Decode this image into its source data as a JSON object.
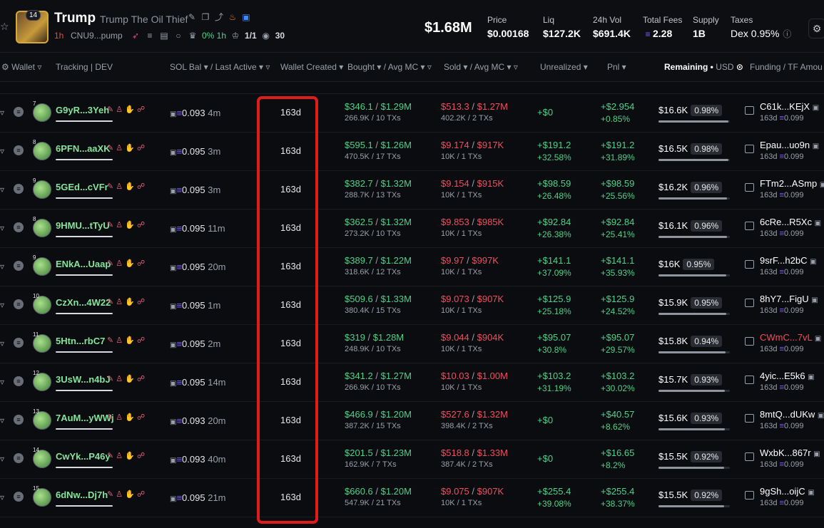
{
  "token": {
    "name": "Trump",
    "subtitle": "Trump The Oil Thief",
    "age": "1h",
    "contract": "CNU9...pump",
    "holders_change": "0% 1h",
    "ratio": "1/1",
    "watchers": "30",
    "logo_badge": "14",
    "market_cap": "$1.68M"
  },
  "stats": [
    {
      "label": "Price",
      "value": "$0.00168"
    },
    {
      "label": "Liq",
      "value": "$127.2K"
    },
    {
      "label": "24h Vol",
      "value": "$691.4K"
    },
    {
      "label": "Total Fees",
      "value": "2.28"
    },
    {
      "label": "Supply",
      "value": "1B"
    },
    {
      "label": "Taxes",
      "value": "Dex 0.95%"
    }
  ],
  "columns": {
    "wallet": "Wallet",
    "tracking": "Tracking",
    "dev": "DEV",
    "sol_bal": "SOL Bal",
    "last_active": "Last Active",
    "wallet_created": "Wallet Created",
    "bought": "Bought",
    "avg_mc": "Avg MC",
    "sold": "Sold",
    "avg_mc2": "Avg MC",
    "unrealized": "Unrealized",
    "pnl": "Pnl",
    "remaining": "Remaining",
    "usd": "USD",
    "funding": "Funding / TF Amou"
  },
  "rows": [
    {
      "rank": "7",
      "wallet": "G9yR...3Yeh",
      "sol": "0.093",
      "ago": "4m",
      "created": "163d",
      "bought": "$346.1",
      "bought_mc": "$1.29M",
      "bought_sub": "266.9K / 10 TXs",
      "sold": "$513.3",
      "sold_mc": "$1.27M",
      "sold_sub": "402.2K / 2 TXs",
      "unreal": "+$0",
      "unreal_pct": "",
      "pnl": "+$2.954",
      "pnl_pct": "+0.85%",
      "remain": "$16.6K",
      "remain_pct": "0.98%",
      "remain_fill": 0.98,
      "fund": "C61k...KEjX",
      "fund_sub": "163d",
      "fund_amt": "0.099",
      "fund_red": false
    },
    {
      "rank": "8",
      "wallet": "6PFN...aaXK",
      "sol": "0.095",
      "ago": "3m",
      "created": "163d",
      "bought": "$595.1",
      "bought_mc": "$1.26M",
      "bought_sub": "470.5K / 17 TXs",
      "sold": "$9.174",
      "sold_mc": "$917K",
      "sold_sub": "10K / 1 TXs",
      "unreal": "+$191.2",
      "unreal_pct": "+32.58%",
      "pnl": "+$191.2",
      "pnl_pct": "+31.89%",
      "remain": "$16.5K",
      "remain_pct": "0.98%",
      "remain_fill": 0.98,
      "fund": "Epau...uo9n",
      "fund_sub": "163d",
      "fund_amt": "0.099",
      "fund_red": false
    },
    {
      "rank": "9",
      "wallet": "5GEd...cVFr",
      "sol": "0.095",
      "ago": "3m",
      "created": "163d",
      "bought": "$382.7",
      "bought_mc": "$1.32M",
      "bought_sub": "288.7K / 13 TXs",
      "sold": "$9.154",
      "sold_mc": "$915K",
      "sold_sub": "10K / 1 TXs",
      "unreal": "+$98.59",
      "unreal_pct": "+26.48%",
      "pnl": "+$98.59",
      "pnl_pct": "+25.56%",
      "remain": "$16.2K",
      "remain_pct": "0.96%",
      "remain_fill": 0.96,
      "fund": "FTm2...ASmp",
      "fund_sub": "163d",
      "fund_amt": "0.099",
      "fund_red": false
    },
    {
      "rank": "8",
      "wallet": "9HMU...tTyU",
      "sol": "0.095",
      "ago": "11m",
      "created": "163d",
      "bought": "$362.5",
      "bought_mc": "$1.32M",
      "bought_sub": "273.2K / 10 TXs",
      "sold": "$9.853",
      "sold_mc": "$985K",
      "sold_sub": "10K / 1 TXs",
      "unreal": "+$92.84",
      "unreal_pct": "+26.38%",
      "pnl": "+$92.84",
      "pnl_pct": "+25.41%",
      "remain": "$16.1K",
      "remain_pct": "0.96%",
      "remain_fill": 0.96,
      "fund": "6cRe...R5Xc",
      "fund_sub": "163d",
      "fund_amt": "0.099",
      "fund_red": false
    },
    {
      "rank": "9",
      "wallet": "ENkA...Uaap",
      "sol": "0.095",
      "ago": "20m",
      "created": "163d",
      "bought": "$389.7",
      "bought_mc": "$1.22M",
      "bought_sub": "318.6K / 12 TXs",
      "sold": "$9.97",
      "sold_mc": "$997K",
      "sold_sub": "10K / 1 TXs",
      "unreal": "+$141.1",
      "unreal_pct": "+37.09%",
      "pnl": "+$141.1",
      "pnl_pct": "+35.93%",
      "remain": "$16K",
      "remain_pct": "0.95%",
      "remain_fill": 0.95,
      "fund": "9srF...h2bC",
      "fund_sub": "163d",
      "fund_amt": "0.099",
      "fund_red": false
    },
    {
      "rank": "10",
      "wallet": "CzXn...4W22",
      "sol": "0.095",
      "ago": "1m",
      "created": "163d",
      "bought": "$509.6",
      "bought_mc": "$1.33M",
      "bought_sub": "380.4K / 15 TXs",
      "sold": "$9.073",
      "sold_mc": "$907K",
      "sold_sub": "10K / 1 TXs",
      "unreal": "+$125.9",
      "unreal_pct": "+25.18%",
      "pnl": "+$125.9",
      "pnl_pct": "+24.52%",
      "remain": "$15.9K",
      "remain_pct": "0.95%",
      "remain_fill": 0.95,
      "fund": "8hY7...FigU",
      "fund_sub": "163d",
      "fund_amt": "0.099",
      "fund_red": false
    },
    {
      "rank": "11",
      "wallet": "5Htn...rbC7",
      "sol": "0.095",
      "ago": "2m",
      "created": "163d",
      "bought": "$319",
      "bought_mc": "$1.28M",
      "bought_sub": "248.9K / 10 TXs",
      "sold": "$9.044",
      "sold_mc": "$904K",
      "sold_sub": "10K / 1 TXs",
      "unreal": "+$95.07",
      "unreal_pct": "+30.8%",
      "pnl": "+$95.07",
      "pnl_pct": "+29.57%",
      "remain": "$15.8K",
      "remain_pct": "0.94%",
      "remain_fill": 0.94,
      "fund": "CWmC...7vL",
      "fund_sub": "163d",
      "fund_amt": "0.099",
      "fund_red": true
    },
    {
      "rank": "12",
      "wallet": "3UsW...n4bJ",
      "sol": "0.095",
      "ago": "14m",
      "created": "163d",
      "bought": "$341.2",
      "bought_mc": "$1.27M",
      "bought_sub": "266.9K / 10 TXs",
      "sold": "$10.03",
      "sold_mc": "$1.00M",
      "sold_sub": "10K / 1 TXs",
      "unreal": "+$103.2",
      "unreal_pct": "+31.19%",
      "pnl": "+$103.2",
      "pnl_pct": "+30.02%",
      "remain": "$15.7K",
      "remain_pct": "0.93%",
      "remain_fill": 0.93,
      "fund": "4yic...E5k6",
      "fund_sub": "163d",
      "fund_amt": "0.099",
      "fund_red": false
    },
    {
      "rank": "13",
      "wallet": "7AuM...yWWj",
      "sol": "0.093",
      "ago": "20m",
      "created": "163d",
      "bought": "$466.9",
      "bought_mc": "$1.20M",
      "bought_sub": "387.2K / 15 TXs",
      "sold": "$527.6",
      "sold_mc": "$1.32M",
      "sold_sub": "398.4K / 2 TXs",
      "unreal": "+$0",
      "unreal_pct": "",
      "pnl": "+$40.57",
      "pnl_pct": "+8.62%",
      "remain": "$15.6K",
      "remain_pct": "0.93%",
      "remain_fill": 0.93,
      "fund": "8mtQ...dUKw",
      "fund_sub": "163d",
      "fund_amt": "0.099",
      "fund_red": false
    },
    {
      "rank": "14",
      "wallet": "CwYk...P46y",
      "sol": "0.093",
      "ago": "40m",
      "created": "163d",
      "bought": "$201.5",
      "bought_mc": "$1.23M",
      "bought_sub": "162.9K / 7 TXs",
      "sold": "$518.8",
      "sold_mc": "$1.33M",
      "sold_sub": "387.4K / 2 TXs",
      "unreal": "+$0",
      "unreal_pct": "",
      "pnl": "+$16.65",
      "pnl_pct": "+8.2%",
      "remain": "$15.5K",
      "remain_pct": "0.92%",
      "remain_fill": 0.92,
      "fund": "WxbK...867r",
      "fund_sub": "163d",
      "fund_amt": "0.099",
      "fund_red": false
    },
    {
      "rank": "15",
      "wallet": "6dNw...Dj7h",
      "sol": "0.095",
      "ago": "21m",
      "created": "163d",
      "bought": "$660.6",
      "bought_mc": "$1.20M",
      "bought_sub": "547.9K / 21 TXs",
      "sold": "$9.075",
      "sold_mc": "$907K",
      "sold_sub": "10K / 1 TXs",
      "unreal": "+$255.4",
      "unreal_pct": "+39.08%",
      "pnl": "+$255.4",
      "pnl_pct": "+38.37%",
      "remain": "$15.5K",
      "remain_pct": "0.92%",
      "remain_fill": 0.92,
      "fund": "9gSh...oijC",
      "fund_sub": "163d",
      "fund_amt": "0.099",
      "fund_red": false
    }
  ]
}
